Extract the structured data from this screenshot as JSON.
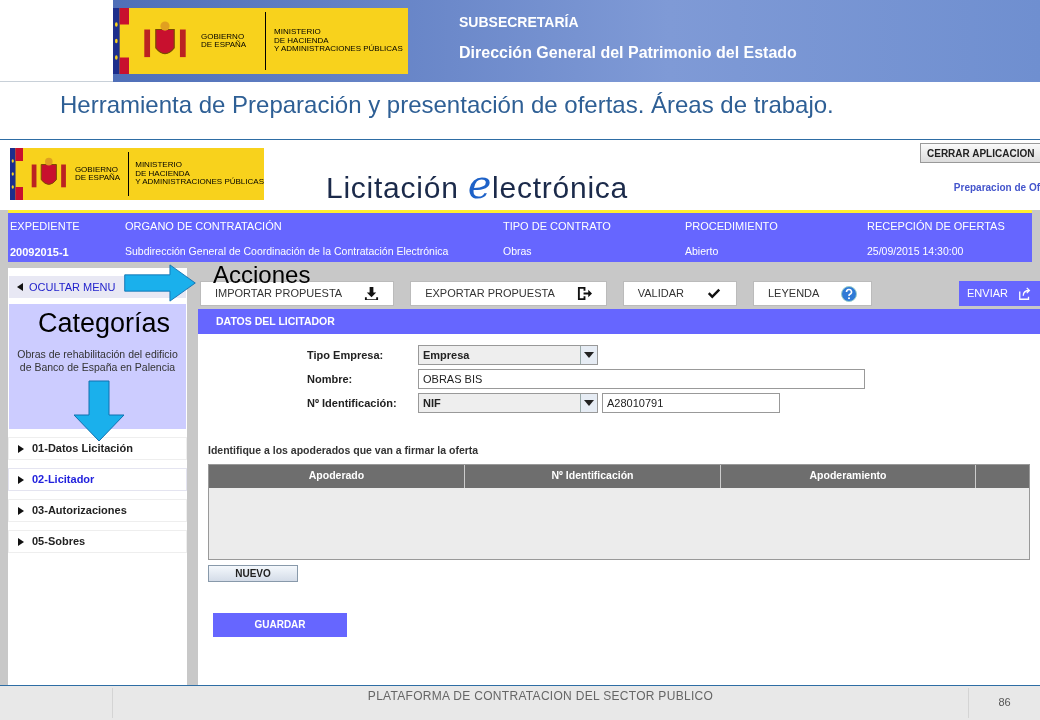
{
  "slide": {
    "department": "SUBSECRETARÍA",
    "directorate": "Dirección General del Patrimonio del Estado",
    "title": "Herramienta de Preparación y presentación de ofertas. Áreas de trabajo.",
    "footer": "PLATAFORMA DE CONTRATACION DEL SECTOR PUBLICO",
    "page_number": "86"
  },
  "slide_logo": {
    "government": [
      "GOBIERNO",
      "DE ESPAÑA"
    ],
    "ministry": [
      "MINISTERIO",
      "DE HACIENDA",
      "Y ADMINISTRACIONES PÚBLICAS"
    ]
  },
  "app_logo": {
    "government": [
      "GOBIERNO",
      "DE ESPAÑA"
    ],
    "ministry": [
      "MINISTERIO",
      "DE HACIENDA",
      "Y ADMINISTRACIONES PÚBLICAS"
    ]
  },
  "annotations": {
    "actions": "Acciones",
    "categories": "Categorías"
  },
  "app": {
    "brand": {
      "before": "Licitación",
      "initial": "e",
      "after": "lectrónica"
    },
    "close_button": "CERRAR APLICACION",
    "breadcrumb": "Preparacion de Of",
    "summary": [
      {
        "label": "EXPEDIENTE",
        "value": "20092015-1"
      },
      {
        "label": "ORGANO DE CONTRATACIÓN",
        "value": "Subdirección General de Coordinación de la Contratación Electrónica"
      },
      {
        "label": "TIPO DE CONTRATO",
        "value": "Obras"
      },
      {
        "label": "PROCEDIMIENTO",
        "value": "Abierto"
      },
      {
        "label": "RECEPCIÓN DE OFERTAS",
        "value": "25/09/2015 14:30:00"
      }
    ],
    "sidebar": {
      "hide_menu": "OCULTAR MENU",
      "description": "Obras de rehabilitación del edificio de Banco de España en Palencia",
      "items": [
        {
          "label": "01-Datos Licitación",
          "selected": false
        },
        {
          "label": "02-Licitador",
          "selected": true
        },
        {
          "label": "03-Autorizaciones",
          "selected": false
        },
        {
          "label": "05-Sobres",
          "selected": false
        }
      ]
    },
    "toolbar": [
      {
        "label": "IMPORTAR PROPUESTA",
        "kind": "import"
      },
      {
        "label": "EXPORTAR PROPUESTA",
        "kind": "export"
      },
      {
        "label": "VALIDAR",
        "kind": "check"
      },
      {
        "label": "LEYENDA",
        "kind": "help"
      }
    ],
    "send_button": "ENVIAR",
    "section_title": "DATOS DEL LICITADOR",
    "form": [
      {
        "kind": "select",
        "label": "Tipo Empresa:",
        "value": "Empresa"
      },
      {
        "kind": "text",
        "label": "Nombre:",
        "value": "OBRAS BIS"
      },
      {
        "kind": "select_text",
        "label": "Nº Identificación:",
        "value": "NIF",
        "number": "A28010791"
      }
    ],
    "representatives": {
      "caption": "Identifique a los apoderados que van a firmar la oferta",
      "columns": [
        "Apoderado",
        "Nº Identificación",
        "Apoderamiento"
      ]
    },
    "new_button": "NUEVO",
    "save_button": "GUARDAR"
  }
}
